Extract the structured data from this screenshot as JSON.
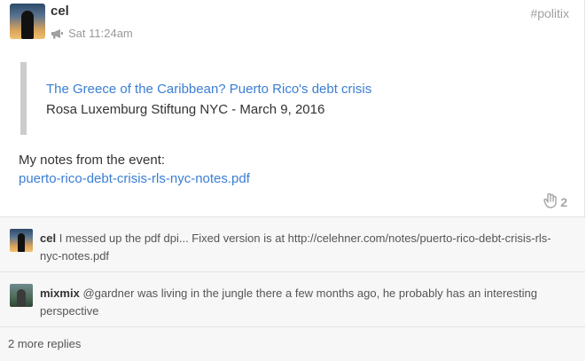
{
  "post": {
    "author": "cel",
    "time": "Sat 11:24am",
    "tag": "#politix",
    "quote": {
      "title": "The Greece of the Caribbean? Puerto Rico's debt crisis",
      "subtitle": "Rosa Luxemburg Stiftung NYC - March 9, 2016"
    },
    "notes_intro": "My notes from the event:",
    "notes_link": "puerto-rico-debt-crisis-rls-nyc-notes.pdf",
    "likes": "2",
    "icons": {
      "megaphone": "megaphone-icon",
      "like": "hand-icon"
    }
  },
  "comments": [
    {
      "author": "cel",
      "text": "I messed up the pdf dpi... Fixed version is at http://celehner.com/notes/puerto-rico-debt-crisis-rls-nyc-notes.pdf"
    },
    {
      "author": "mixmix",
      "text": "@gardner was living in the jungle there a few months ago, he probably has an interesting perspective"
    }
  ],
  "more_replies": "2 more replies",
  "colors": {
    "link": "#3a7ed5",
    "muted": "#9a9a9a",
    "quote_bar": "#cccccc",
    "comment_bg": "#f7f7f7"
  }
}
